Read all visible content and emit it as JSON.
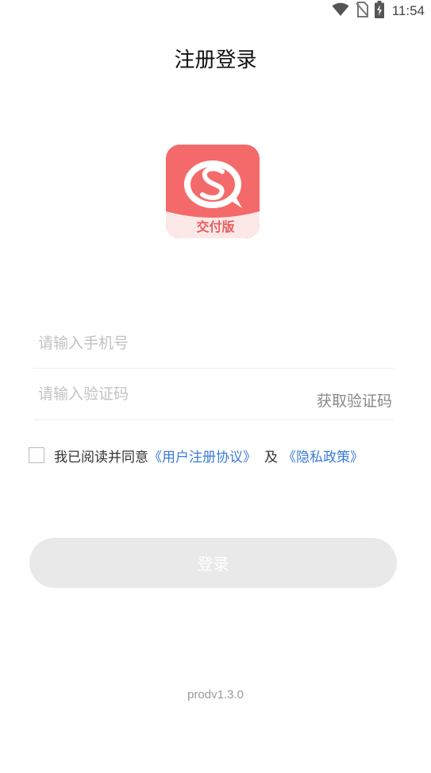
{
  "status_bar": {
    "time": "11:54",
    "icons": [
      "wifi-icon",
      "no-sim-icon",
      "battery-charging-icon"
    ]
  },
  "header": {
    "title": "注册登录"
  },
  "logo": {
    "banner_text": "交付版",
    "colors": {
      "background": "#f46a6a",
      "banner": "#fde8e8"
    }
  },
  "form": {
    "phone_placeholder": "请输入手机号",
    "phone_value": "",
    "code_placeholder": "请输入验证码",
    "code_value": "",
    "get_code_label": "获取验证码"
  },
  "agreement": {
    "checked": false,
    "text": "我已阅读并同意",
    "terms_link": "《用户注册协议》",
    "and_text": "及",
    "privacy_link": "《隐私政策》"
  },
  "login_button": {
    "label": "登录"
  },
  "footer": {
    "version": "prodv1.3.0"
  },
  "colors": {
    "link": "#3a7bd5",
    "button_disabled": "#e9e9e9",
    "brand": "#f46a6a"
  }
}
